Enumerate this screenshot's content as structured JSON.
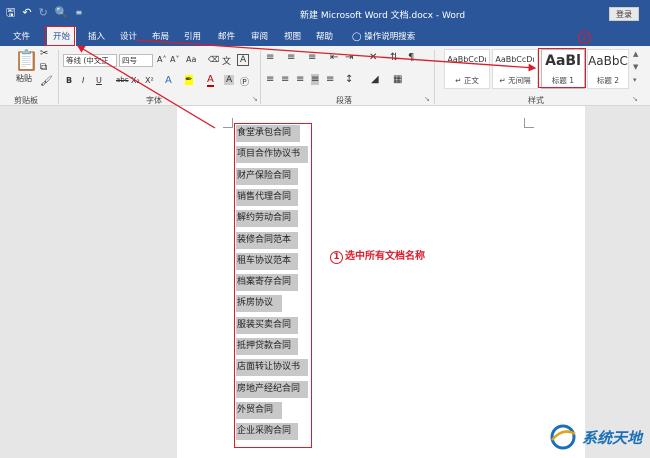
{
  "titlebar": {
    "title": "新建 Microsoft Word 文档.docx - Word",
    "login": "登录",
    "qat_icons": [
      "save-icon",
      "undo-icon",
      "redo-icon",
      "print-preview-icon",
      "customize-icon"
    ]
  },
  "tabs": [
    "文件",
    "开始",
    "插入",
    "设计",
    "布局",
    "引用",
    "邮件",
    "审阅",
    "视图",
    "帮助"
  ],
  "tell_me": "操作说明搜索",
  "ribbon": {
    "clipboard": {
      "paste": "粘贴",
      "label": "剪贴板"
    },
    "font": {
      "font_name": "等线 (中文正",
      "font_size": "四号",
      "grow": "A˄",
      "shrink": "A˅",
      "case": "Aa",
      "bold": "B",
      "italic": "I",
      "underline": "U",
      "strike": "abc",
      "sub": "X₂",
      "sup": "X²",
      "label": "字体"
    },
    "paragraph": {
      "label": "段落"
    },
    "styles": {
      "label": "样式",
      "items": [
        {
          "sample": "AaBbCcDı",
          "name": "↵ 正文"
        },
        {
          "sample": "AaBbCcDı",
          "name": "↵ 无间隔"
        },
        {
          "sample": "AaBl",
          "name": "标题 1"
        },
        {
          "sample": "AaBbC",
          "name": "标题 2"
        }
      ]
    }
  },
  "document": {
    "lines": [
      "食堂承包合同",
      "项目合作协议书",
      "财产保险合同",
      "销售代理合同",
      "解约劳动合同",
      "装修合同范本",
      "租车协议范本",
      "档案寄存合同",
      "拆房协议",
      "服装买卖合同",
      "抵押贷款合同",
      "店面转让协议书",
      "房地产经纪合同",
      "外贸合同",
      "企业采购合同"
    ]
  },
  "annotations": {
    "step1_num": "1",
    "step1_text": "选中所有文档名称",
    "step2_num": "2",
    "color": "#d81e2c"
  },
  "watermark": {
    "text": "系统天地"
  }
}
